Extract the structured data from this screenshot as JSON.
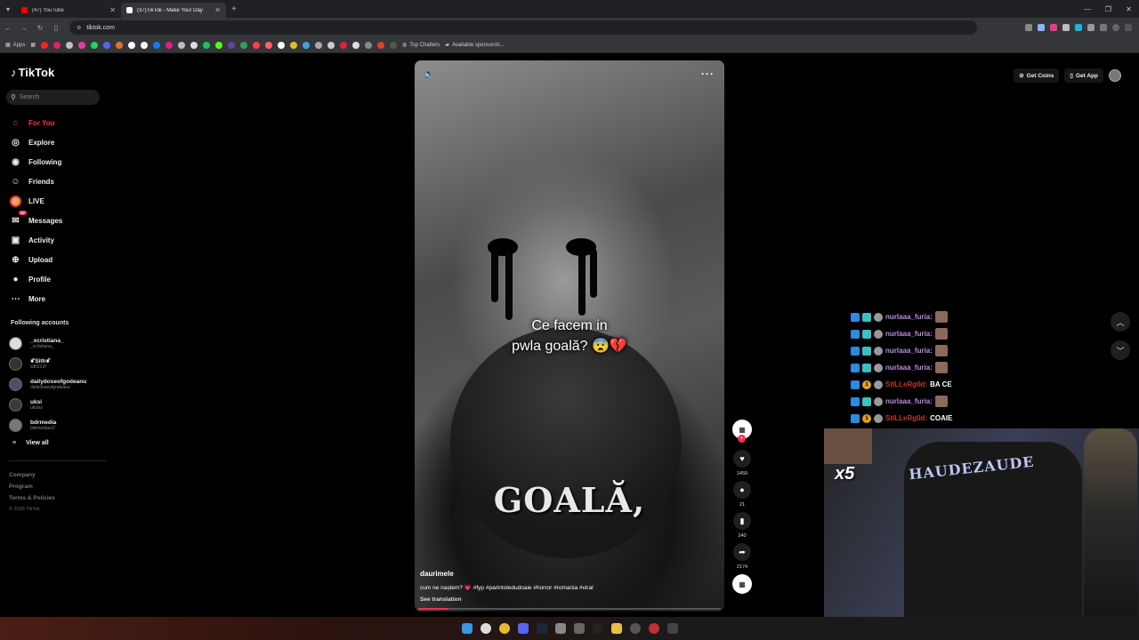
{
  "browser": {
    "tabs": [
      {
        "title": "(47) YouTube",
        "color": "#ff0000"
      },
      {
        "title": "(37)TikTok - Make Your Day",
        "color": "#ffffff"
      }
    ],
    "url": "tiktok.com",
    "bookmarks": {
      "apps": "Apps",
      "top_chatters": "Top Chatters",
      "sponsorship": "Available sponsorsh..."
    }
  },
  "sidebar": {
    "logo": "TikTok",
    "search_placeholder": "Search",
    "nav": [
      {
        "label": "For You",
        "icon": "home-icon",
        "glyph": "⌂",
        "active": true
      },
      {
        "label": "Explore",
        "icon": "compass-icon",
        "glyph": "◎"
      },
      {
        "label": "Following",
        "icon": "following-icon",
        "glyph": "◉"
      },
      {
        "label": "Friends",
        "icon": "friends-icon",
        "glyph": "☺"
      },
      {
        "label": "LIVE",
        "icon": "live-icon",
        "glyph": ""
      },
      {
        "label": "Messages",
        "icon": "messages-icon",
        "glyph": "✉",
        "badge": "37"
      },
      {
        "label": "Activity",
        "icon": "activity-icon",
        "glyph": "▣"
      },
      {
        "label": "Upload",
        "icon": "upload-icon",
        "glyph": "⊕"
      },
      {
        "label": "Profile",
        "icon": "profile-icon",
        "glyph": "●"
      },
      {
        "label": "More",
        "icon": "more-icon",
        "glyph": "⋯"
      }
    ],
    "following_title": "Following accounts",
    "accounts": [
      {
        "name": "_xcristiana_",
        "handle": "_xcristiana_"
      },
      {
        "name": "ꗄSithꗄ",
        "handle": "sith2197"
      },
      {
        "name": "dailydoseofgodeanu",
        "handle": "dailydoseofgodeanu"
      },
      {
        "name": "uksi",
        "handle": "uksiss"
      },
      {
        "name": "bdrmedia",
        "handle": "bdrmediaro2"
      }
    ],
    "view_all": "View all",
    "footer": [
      "Company",
      "Program",
      "Terms & Policies"
    ],
    "copyright": "© 2026 TikTok"
  },
  "video": {
    "caption_line1": "Ce facem in",
    "caption_line2": "pwla goală? 😨💔",
    "big_word": "GOALĂ,",
    "author": "daurimele",
    "description": "cum ne naștem? 💗 #fyp #parintoledudoaie #horror #romania #viral",
    "see_translation": "See translation",
    "progress": 0.1
  },
  "actions": {
    "likes": "1459",
    "comments": "21",
    "saves": "240",
    "shares": "2174"
  },
  "header": {
    "get_coins": "Get Coins",
    "get_app": "Get App"
  },
  "chat": [
    {
      "user": "nurlaaa_furia:",
      "color": "purple",
      "text": "",
      "emote": true,
      "badges": [
        "blue",
        "teal",
        "gray"
      ]
    },
    {
      "user": "nurlaaa_furia:",
      "color": "purple",
      "text": "",
      "emote": true,
      "badges": [
        "blue",
        "teal",
        "gray"
      ]
    },
    {
      "user": "nurlaaa_furia:",
      "color": "purple",
      "text": "",
      "emote": true,
      "badges": [
        "blue",
        "teal",
        "gray"
      ]
    },
    {
      "user": "nurlaaa_furia:",
      "color": "purple",
      "text": "",
      "emote": true,
      "badges": [
        "blue",
        "teal",
        "gray"
      ]
    },
    {
      "user": "StILLeRg0d:",
      "color": "red",
      "text": "BA CE",
      "emote": false,
      "badges": [
        "blue",
        "gold",
        "gray"
      ]
    },
    {
      "user": "nurlaaa_furia:",
      "color": "purple",
      "text": "",
      "emote": true,
      "badges": [
        "blue",
        "teal",
        "gray"
      ]
    },
    {
      "user": "StILLeRg0d:",
      "color": "red",
      "text": "COAIE",
      "emote": false,
      "badges": [
        "blue",
        "gold",
        "gray"
      ]
    }
  ],
  "webcam": {
    "multiplier": "x5",
    "shirt_text": "HAUDEZAUDE"
  }
}
